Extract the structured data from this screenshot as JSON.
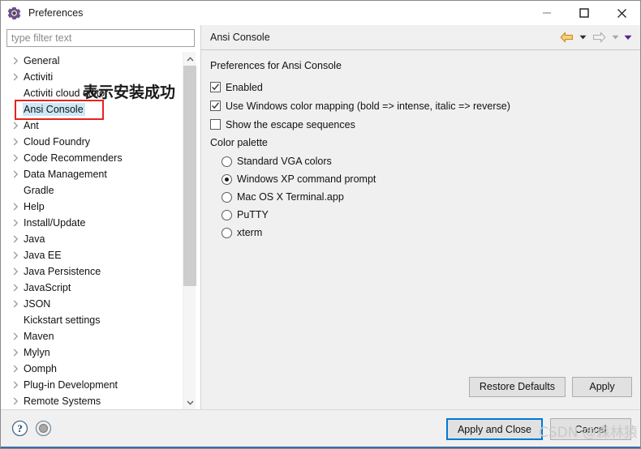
{
  "window": {
    "title": "Preferences",
    "icon": "gear-icon",
    "controls": {
      "minimize": "minimize-icon",
      "maximize": "maximize-icon",
      "close": "close-icon"
    }
  },
  "colors": {
    "selection_blue": "#cde8f6",
    "annotation_red": "#e8231c",
    "default_button_border": "#0078d7",
    "accent_line": "#3a6ea5",
    "back_arrow_gold": "#e8a33d",
    "forward_arrow_gray": "#b8b8b8",
    "purple_triangle": "#6a0dad",
    "gear_purple": "#6b4f8a"
  },
  "filter": {
    "placeholder": "type filter text",
    "value": ""
  },
  "tree": {
    "items": [
      {
        "label": "General",
        "expandable": true,
        "selected": false,
        "indent": 0
      },
      {
        "label": "Activiti",
        "expandable": true,
        "selected": false,
        "indent": 0
      },
      {
        "label": "Activiti cloud editor",
        "expandable": false,
        "selected": false,
        "indent": 0
      },
      {
        "label": "Ansi Console",
        "expandable": false,
        "selected": true,
        "indent": 0
      },
      {
        "label": "Ant",
        "expandable": true,
        "selected": false,
        "indent": 0
      },
      {
        "label": "Cloud Foundry",
        "expandable": true,
        "selected": false,
        "indent": 0
      },
      {
        "label": "Code Recommenders",
        "expandable": true,
        "selected": false,
        "indent": 0
      },
      {
        "label": "Data Management",
        "expandable": true,
        "selected": false,
        "indent": 0
      },
      {
        "label": "Gradle",
        "expandable": false,
        "selected": false,
        "indent": 0
      },
      {
        "label": "Help",
        "expandable": true,
        "selected": false,
        "indent": 0
      },
      {
        "label": "Install/Update",
        "expandable": true,
        "selected": false,
        "indent": 0
      },
      {
        "label": "Java",
        "expandable": true,
        "selected": false,
        "indent": 0
      },
      {
        "label": "Java EE",
        "expandable": true,
        "selected": false,
        "indent": 0
      },
      {
        "label": "Java Persistence",
        "expandable": true,
        "selected": false,
        "indent": 0
      },
      {
        "label": "JavaScript",
        "expandable": true,
        "selected": false,
        "indent": 0
      },
      {
        "label": "JSON",
        "expandable": true,
        "selected": false,
        "indent": 0
      },
      {
        "label": "Kickstart settings",
        "expandable": false,
        "selected": false,
        "indent": 0
      },
      {
        "label": "Maven",
        "expandable": true,
        "selected": false,
        "indent": 0
      },
      {
        "label": "Mylyn",
        "expandable": true,
        "selected": false,
        "indent": 0
      },
      {
        "label": "Oomph",
        "expandable": true,
        "selected": false,
        "indent": 0
      },
      {
        "label": "Plug-in Development",
        "expandable": true,
        "selected": false,
        "indent": 0
      },
      {
        "label": "Remote Systems",
        "expandable": true,
        "selected": false,
        "indent": 0
      }
    ],
    "scrollbar": {
      "up": "scroll-up-arrow",
      "down": "scroll-down-arrow"
    }
  },
  "panel": {
    "title": "Ansi Console",
    "nav": {
      "back": "back-arrow-icon",
      "back_dropdown": "chevron-down-icon",
      "forward": "forward-arrow-icon",
      "forward_dropdown": "chevron-down-icon",
      "menu_dropdown": "chevron-down-icon"
    },
    "heading": "Preferences for Ansi Console",
    "checkboxes": [
      {
        "label": "Enabled",
        "checked": true
      },
      {
        "label": "Use Windows color mapping (bold => intense, italic => reverse)",
        "checked": true
      },
      {
        "label": "Show the escape sequences",
        "checked": false
      }
    ],
    "palette_label": "Color palette",
    "radios": [
      {
        "label": "Standard VGA colors",
        "selected": false
      },
      {
        "label": "Windows XP command prompt",
        "selected": true
      },
      {
        "label": "Mac OS X Terminal.app",
        "selected": false
      },
      {
        "label": "PuTTY",
        "selected": false
      },
      {
        "label": "xterm",
        "selected": false
      }
    ],
    "buttons": {
      "restore_defaults": "Restore Defaults",
      "apply": "Apply"
    }
  },
  "bottom_bar": {
    "help_icon": "help-icon",
    "status_icon": "circle-icon",
    "apply_and_close": "Apply and Close",
    "cancel": "Cancel"
  },
  "annotations": {
    "chinese_note": "表示安装成功",
    "watermark": "CSDN @森林猿"
  }
}
